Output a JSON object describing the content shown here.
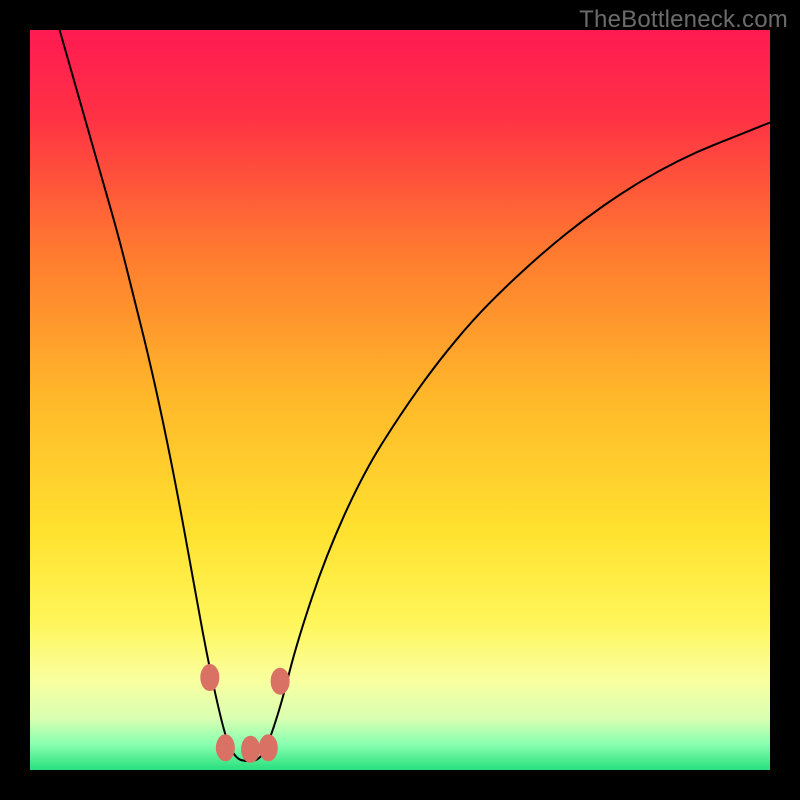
{
  "watermark": "TheBottleneck.com",
  "chart_data": {
    "type": "line",
    "title": "",
    "xlabel": "",
    "ylabel": "",
    "xlim": [
      0,
      100
    ],
    "ylim": [
      0,
      100
    ],
    "background": {
      "type": "vertical-gradient",
      "stops": [
        {
          "offset": 0.0,
          "color": "#ff1a52"
        },
        {
          "offset": 0.12,
          "color": "#ff3244"
        },
        {
          "offset": 0.3,
          "color": "#ff7a2f"
        },
        {
          "offset": 0.5,
          "color": "#ffb92a"
        },
        {
          "offset": 0.68,
          "color": "#ffe22f"
        },
        {
          "offset": 0.8,
          "color": "#fff65a"
        },
        {
          "offset": 0.88,
          "color": "#f9ffa0"
        },
        {
          "offset": 0.93,
          "color": "#d9ffb2"
        },
        {
          "offset": 0.965,
          "color": "#8affb0"
        },
        {
          "offset": 1.0,
          "color": "#27e07d"
        }
      ]
    },
    "series": [
      {
        "name": "bottleneck-curve",
        "stroke": "#000000",
        "stroke_width": 2,
        "x": [
          4,
          6,
          8,
          10,
          12,
          14,
          16,
          18,
          20,
          22,
          24,
          26,
          27,
          28,
          29,
          30,
          31,
          32,
          34,
          36,
          40,
          45,
          50,
          55,
          60,
          65,
          70,
          75,
          80,
          85,
          90,
          95,
          100
        ],
        "y": [
          100,
          93,
          86,
          79,
          72,
          64,
          56,
          47,
          37,
          26,
          15,
          6,
          3,
          1.5,
          1.2,
          1.2,
          1.5,
          3,
          9,
          17,
          29,
          40,
          48,
          55,
          61,
          66,
          70.5,
          74.5,
          78,
          81,
          83.5,
          85.5,
          87.5
        ]
      }
    ],
    "markers": {
      "name": "highlight-markers",
      "fill": "#d97165",
      "stroke": "#d97165",
      "rx": 9,
      "ry": 13,
      "points": [
        {
          "x": 24.3,
          "y": 12.5
        },
        {
          "x": 26.4,
          "y": 3.0
        },
        {
          "x": 29.8,
          "y": 2.8
        },
        {
          "x": 32.2,
          "y": 3.0
        },
        {
          "x": 33.8,
          "y": 12.0
        }
      ]
    }
  }
}
